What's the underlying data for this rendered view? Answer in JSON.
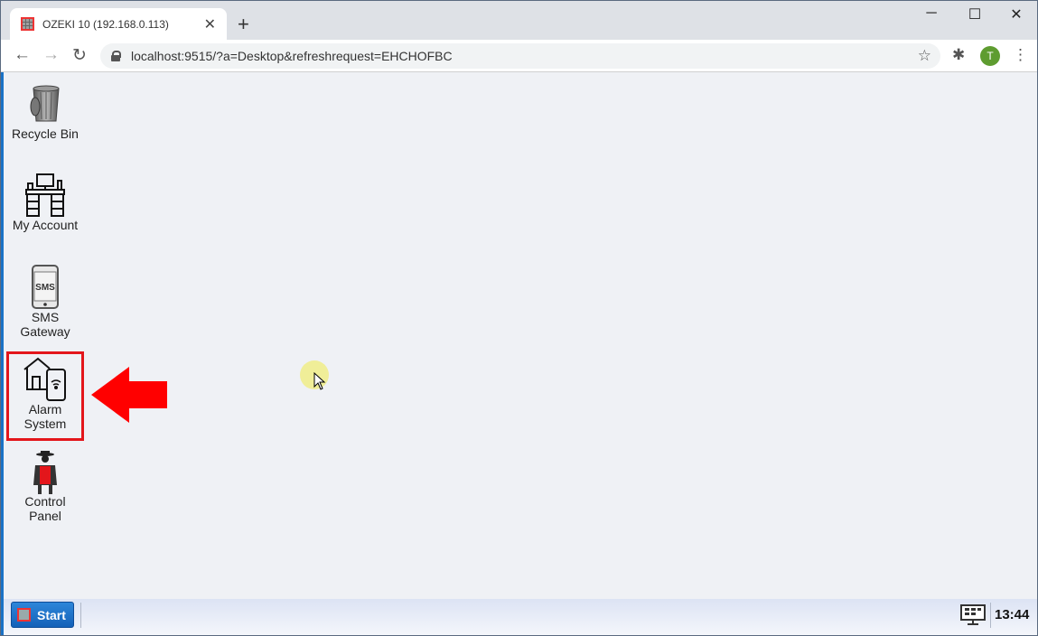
{
  "browser": {
    "tab_title": "OZEKI 10 (192.168.0.113)",
    "tab_close": "✕",
    "new_tab": "+",
    "window_controls": {
      "minimize": "─",
      "maximize": "☐",
      "close": "✕"
    },
    "nav": {
      "back": "←",
      "forward": "→",
      "reload": "↻"
    },
    "url": "localhost:9515/?a=Desktop&refreshrequest=EHCHOFBC",
    "bookmark_star": "☆",
    "profile_initial": "T",
    "menu": "⋮",
    "extensions": "✱"
  },
  "desktop": {
    "icons": [
      {
        "label": "Recycle Bin",
        "icon": "recycle-bin-icon"
      },
      {
        "label": "My Account",
        "icon": "desk-icon"
      },
      {
        "label": "SMS Gateway",
        "icon": "sms-phone-icon"
      },
      {
        "label": "Alarm System",
        "icon": "house-phone-icon",
        "highlighted": true
      },
      {
        "label": "Control Panel",
        "icon": "agent-icon"
      }
    ],
    "highlight_color": "#e3161b"
  },
  "taskbar": {
    "start_label": "Start",
    "clock": "13:44"
  }
}
